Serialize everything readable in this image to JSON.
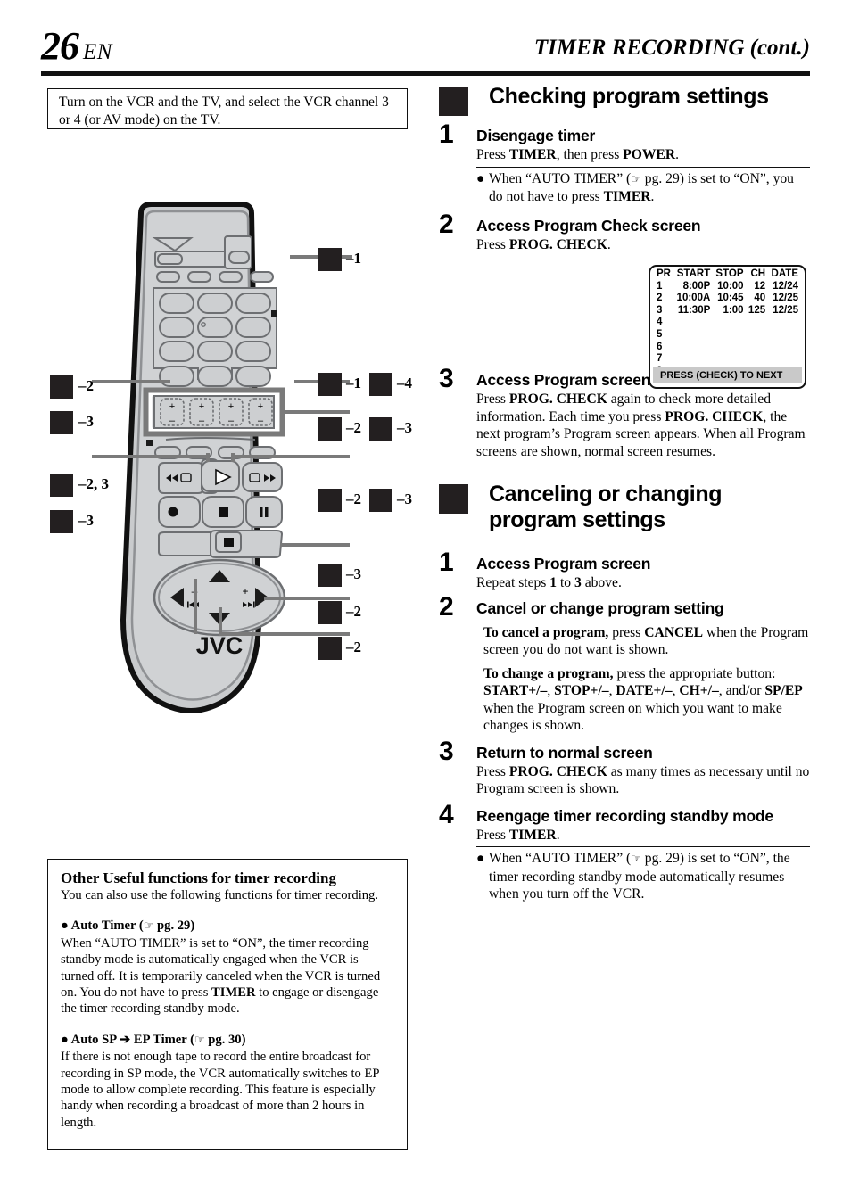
{
  "header": {
    "page_number": "26",
    "lang": "EN",
    "title": "TIMER RECORDING",
    "title_cont": "(cont.)"
  },
  "note_box": {
    "text": "Turn on the VCR and the TV, and select the VCR channel 3 or 4 (or AV mode) on the TV."
  },
  "remote": {
    "brand": "JVC",
    "callouts_left": [
      {
        "label": "–2"
      },
      {
        "label": "–3"
      },
      {
        "label": "–2, 3"
      },
      {
        "label": "–3"
      }
    ],
    "callouts_right": [
      {
        "label": "–1"
      },
      {
        "label": "–1"
      },
      {
        "label": "–4"
      },
      {
        "label": "–2"
      },
      {
        "label": "–3"
      },
      {
        "label": "–2"
      },
      {
        "label": "–3"
      },
      {
        "label": "–3"
      },
      {
        "label": "–2"
      },
      {
        "label": "–2"
      }
    ]
  },
  "section_check": {
    "heading": "Checking program settings",
    "steps": [
      {
        "num": "1",
        "title": "Disengage timer",
        "body_prefix": "Press ",
        "body_b1": "TIMER",
        "body_mid": ", then press ",
        "body_b2": "POWER",
        "body_suffix": ".",
        "note_a": "When “AUTO TIMER” (",
        "note_pg": " pg. 29",
        "note_b": ") is set to “ON”, you do not have to press ",
        "note_b_bold": "TIMER",
        "note_c": "."
      },
      {
        "num": "2",
        "title": "Access Program Check screen",
        "body_prefix": "Press ",
        "body_b1": "PROG. CHECK",
        "body_suffix": "."
      },
      {
        "num": "3",
        "title": "Access Program screen",
        "body_prefix": "Press ",
        "body_b1": "PROG. CHECK",
        "body_mid": " again to check more detailed information. Each time you press ",
        "body_b2": "PROG. CHECK",
        "body_suffix": ", the next program’s Program screen appears. When all Program screens are shown, normal screen resumes."
      }
    ]
  },
  "osd": {
    "columns": [
      "PR",
      "START",
      "STOP",
      "CH",
      "DATE"
    ],
    "rows": [
      [
        "1",
        "8:00P",
        "10:00",
        "12",
        "12/24"
      ],
      [
        "2",
        "10:00A",
        "10:45",
        "40",
        "12/25"
      ],
      [
        "3",
        "11:30P",
        "1:00",
        "125",
        "12/25"
      ],
      [
        "4",
        "",
        "",
        "",
        ""
      ],
      [
        "5",
        "",
        "",
        "",
        ""
      ],
      [
        "6",
        "",
        "",
        "",
        ""
      ],
      [
        "7",
        "",
        "",
        "",
        ""
      ],
      [
        "8",
        "",
        "",
        "",
        ""
      ]
    ],
    "footer": "PRESS (CHECK) TO NEXT"
  },
  "section_cancel": {
    "heading": "Canceling or changing program settings",
    "steps": [
      {
        "num": "1",
        "title": "Access Program screen",
        "body_prefix": "Repeat steps ",
        "body_b1": "1",
        "body_mid": " to ",
        "body_b2": "3",
        "body_suffix": " above."
      },
      {
        "num": "2",
        "title": "Cancel or change program setting",
        "para1_bold": "To cancel a program,",
        "para1_a": " press ",
        "para1_b": "CANCEL",
        "para1_c": " when the Program screen you do not want is shown.",
        "para2_bold": "To change a program,",
        "para2_a": " press the appropriate button: ",
        "para2_b1": "START+/–",
        "para2_s1": ", ",
        "para2_b2": "STOP+/–",
        "para2_s2": ", ",
        "para2_b3": "DATE+/–",
        "para2_s3": ", ",
        "para2_b4": "CH+/–",
        "para2_s4": ", and/or ",
        "para2_b5": "SP/EP",
        "para2_end": " when the Program screen on which you want to make changes is shown."
      },
      {
        "num": "3",
        "title": "Return to normal screen",
        "body_prefix": "Press ",
        "body_b1": "PROG. CHECK",
        "body_suffix": " as many times as necessary until no Program screen is shown."
      },
      {
        "num": "4",
        "title": "Reengage timer recording standby mode",
        "body_prefix": "Press ",
        "body_b1": "TIMER",
        "body_suffix": ".",
        "note_a": "When “AUTO TIMER” (",
        "note_pg": " pg. 29",
        "note_b": ") is set to “ON”, the timer recording standby mode automatically resumes when you turn off the VCR."
      }
    ]
  },
  "useful_box": {
    "title": "Other Useful functions for timer recording",
    "intro": "You can also use the following functions for timer recording.",
    "item1_label": "Auto Timer (",
    "item1_pg": " pg. 29",
    "item1_label_end": ")",
    "item1_body_a": "When “AUTO TIMER” is set to “ON”, the timer recording standby mode is automatically engaged when the VCR is turned off. It is temporarily canceled when the VCR is turned on. You do not have to press ",
    "item1_body_b": "TIMER",
    "item1_body_c": " to engage or disengage the timer recording standby mode.",
    "item2_label": "Auto SP ➔ EP Timer (",
    "item2_pg": " pg. 30",
    "item2_label_end": ")",
    "item2_body": "If there is not enough tape to record the entire broadcast for recording in SP mode, the VCR automatically switches to EP mode to allow complete recording. This feature is especially handy when recording a broadcast of more than 2 hours in length."
  },
  "colors": {
    "ink": "#000000",
    "callout_block": "#231f20",
    "leader_gray": "#7a7a7a",
    "remote_body": "#c9cbcd",
    "osd_footer": "#c9c9c9"
  }
}
